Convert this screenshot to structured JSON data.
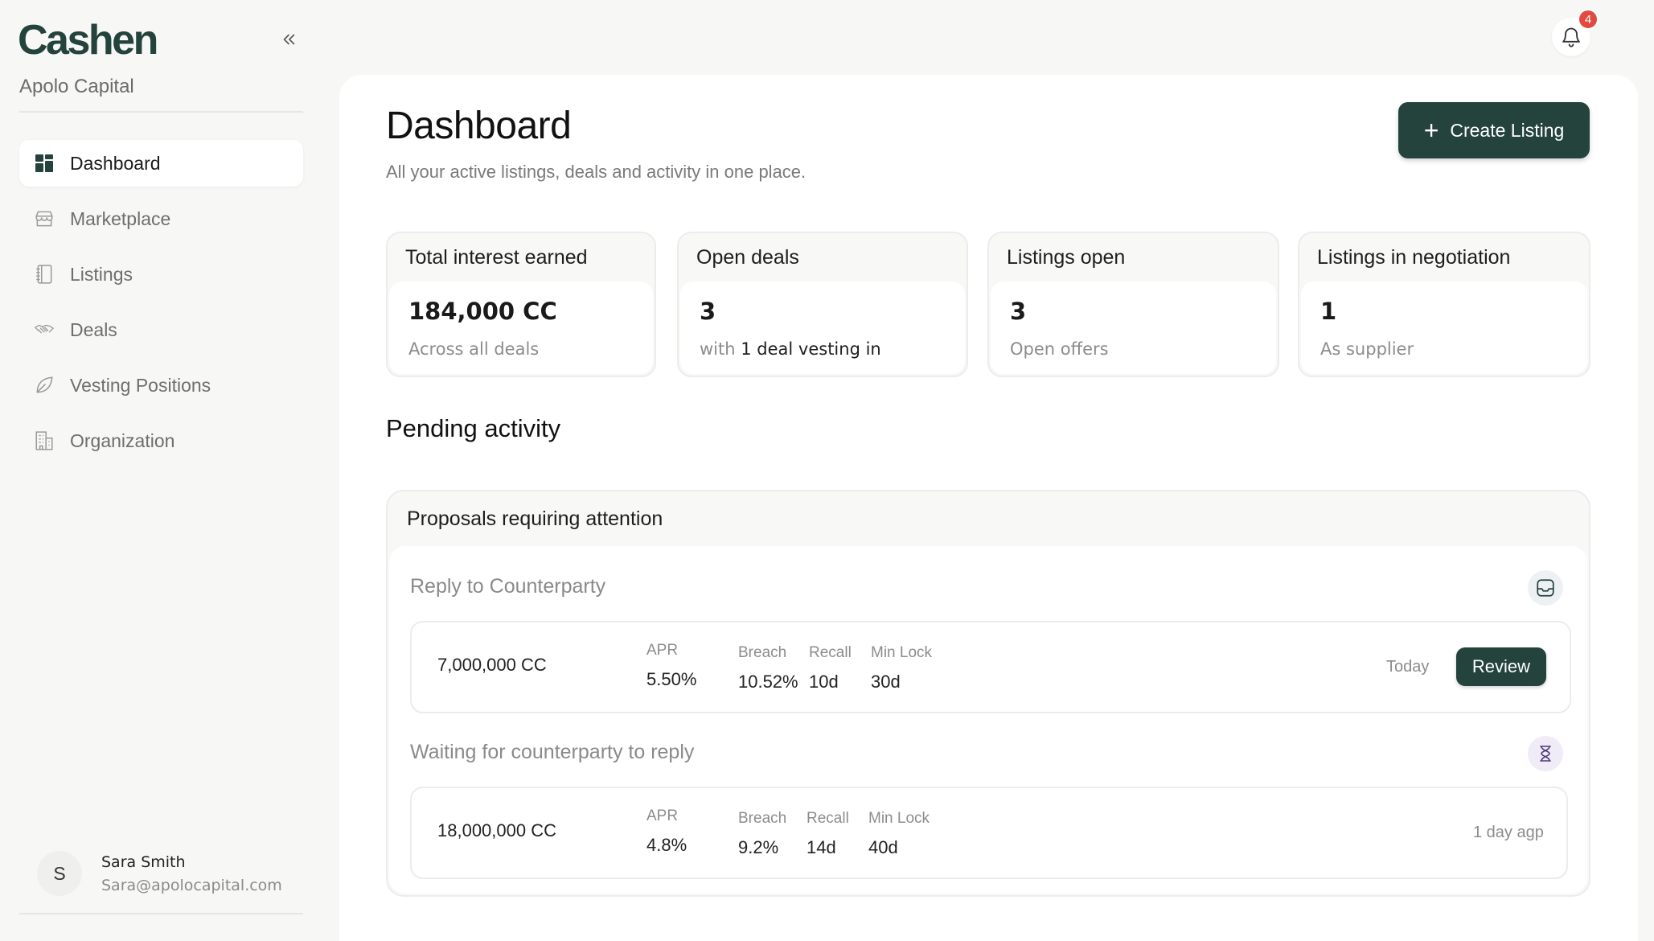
{
  "brand": {
    "logo": "Cashen",
    "organization": "Apolo Capital"
  },
  "nav": {
    "items": [
      {
        "label": "Dashboard",
        "icon": "dashboard-grid-icon",
        "active": true
      },
      {
        "label": "Marketplace",
        "icon": "store-icon",
        "active": false
      },
      {
        "label": "Listings",
        "icon": "notebook-icon",
        "active": false
      },
      {
        "label": "Deals",
        "icon": "handshake-icon",
        "active": false
      },
      {
        "label": "Vesting Positions",
        "icon": "leaf-icon",
        "active": false
      },
      {
        "label": "Organization",
        "icon": "building-icon",
        "active": false
      }
    ]
  },
  "user": {
    "initial": "S",
    "name": "Sara Smith",
    "email": "Sara@apolocapital.com"
  },
  "notifications": {
    "count": "4"
  },
  "header": {
    "title": "Dashboard",
    "subtitle": "All your active listings, deals and activity in one place.",
    "create_label": "Create Listing"
  },
  "stats": [
    {
      "label": "Total interest earned",
      "value": "184,000 CC",
      "sub": "Across all deals"
    },
    {
      "label": "Open deals",
      "value": "3",
      "sub_prefix": "with",
      "sub_strong": "1 deal vesting in"
    },
    {
      "label": "Listings open",
      "value": "3",
      "sub": "Open offers"
    },
    {
      "label": "Listings in negotiation",
      "value": "1",
      "sub": "As supplier"
    }
  ],
  "pending": {
    "title": "Pending activity",
    "card_title": "Proposals requiring attention",
    "groups": [
      {
        "label": "Reply to Counterparty",
        "icon": "inbox-icon",
        "row": {
          "amount": "7,000,000 CC",
          "apr_label": "APR",
          "apr": "5.50%",
          "breach_label": "Breach",
          "breach": "10.52%",
          "recall_label": "Recall",
          "recall": "10d",
          "minlock_label": "Min Lock",
          "minlock": "30d",
          "when": "Today",
          "action": "Review"
        }
      },
      {
        "label": "Waiting for  counterparty to reply",
        "icon": "hourglass-icon",
        "row": {
          "amount": "18,000,000 CC",
          "apr_label": "APR",
          "apr": "4.8%",
          "breach_label": "Breach",
          "breach": "9.2%",
          "recall_label": "Recall",
          "recall": "14d",
          "minlock_label": "Min Lock",
          "minlock": "40d",
          "when": "1 day agp"
        }
      }
    ]
  },
  "colors": {
    "brand": "#24433c",
    "badge": "#e04a3f",
    "muted_text": "#8c8c8c"
  }
}
